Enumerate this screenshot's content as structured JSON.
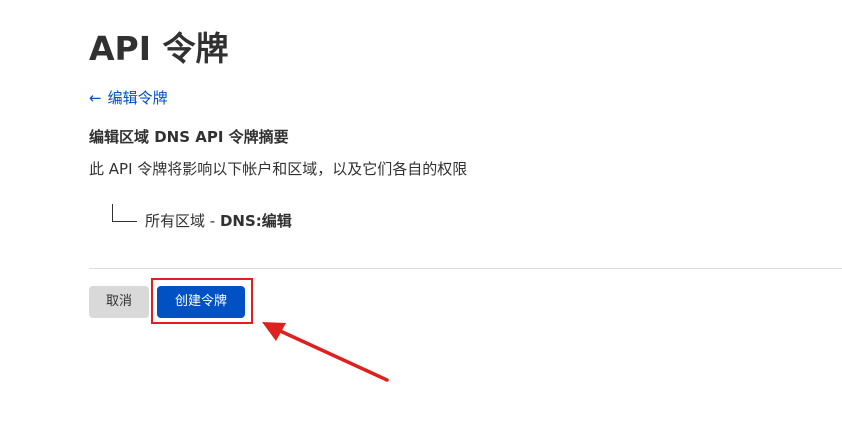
{
  "page": {
    "title": "API 令牌"
  },
  "back_link": {
    "arrow": "←",
    "label": "编辑令牌"
  },
  "summary": {
    "title": "编辑区域 DNS API 令牌摘要",
    "description": "此 API 令牌将影响以下帐户和区域，以及它们各自的权限",
    "item_scope": "所有区域 - ",
    "item_permission": "DNS:编辑"
  },
  "actions": {
    "cancel_label": "取消",
    "create_label": "创建令牌"
  },
  "colors": {
    "link": "#0051c3",
    "primary_button": "#0051c3",
    "cancel_button": "#d9d9d9",
    "annotation": "#e0201e"
  }
}
